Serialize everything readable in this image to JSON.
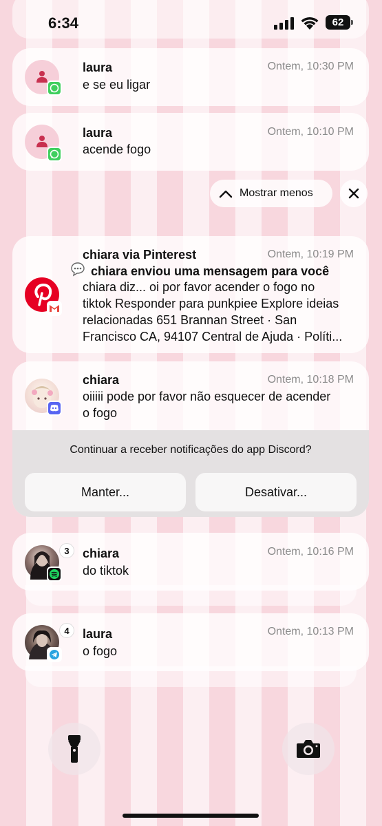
{
  "status_bar": {
    "time": "6:34",
    "battery": "62"
  },
  "notifications": [
    {
      "title": "laura",
      "time": "Ontem, 10:30 PM",
      "body": "e se eu ligar",
      "app": "whatsapp"
    },
    {
      "title": "laura",
      "time": "Ontem, 10:10 PM",
      "body": "acende fogo",
      "app": "whatsapp"
    }
  ],
  "controls": {
    "show_less": "Mostrar menos"
  },
  "pinterest": {
    "title": "chiara via Pinterest",
    "time": "Ontem, 10:19 PM",
    "subject": "chiara enviou uma mensagem para você",
    "body_lines": [
      "chiara diz... oi por favor acender o fogo no",
      "tiktok Responder para punkpiee Explore ideias",
      "relacionadas 651 Brannan Street · San",
      "Francisco CA, 94107 Central de Ajuda · Políti..."
    ]
  },
  "discord": {
    "title": "chiara",
    "time": "Ontem, 10:18 PM",
    "body_lines": [
      "oiiiii pode por favor não esquecer de acender",
      "o fogo"
    ],
    "prompt": "Continuar a receber notificações do app Discord?",
    "keep_label": "Manter...",
    "disable_label": "Desativar..."
  },
  "spotify": {
    "title": "chiara",
    "time": "Ontem, 10:16 PM",
    "body": "do tiktok",
    "count": "3"
  },
  "telegram": {
    "title": "laura",
    "time": "Ontem, 10:13 PM",
    "body": "o fogo",
    "count": "4"
  },
  "colors": {
    "whatsapp": "#3fcf5e",
    "pinterest": "#e60023",
    "discord": "#5865f2",
    "telegram": "#2aa3e0"
  }
}
